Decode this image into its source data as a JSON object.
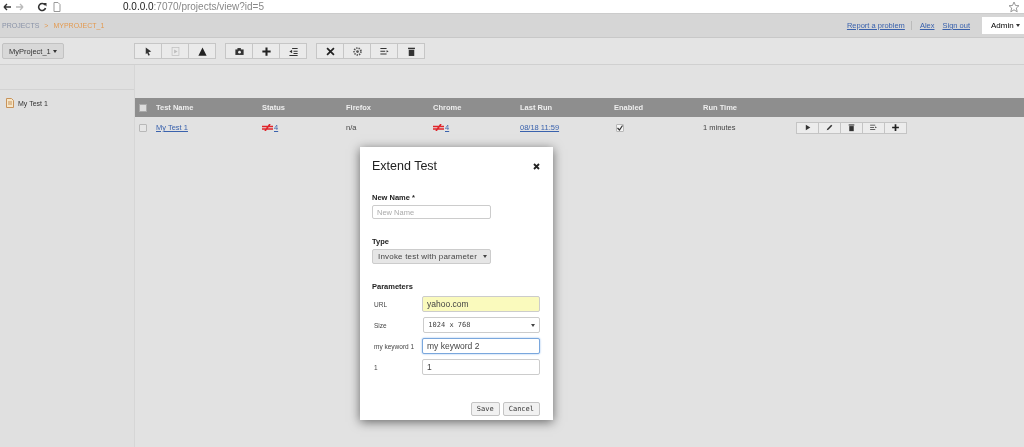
{
  "browser": {
    "url_host": "0.0.0.0",
    "url_path": ":7070/projects/view?id=5"
  },
  "breadcrumb": {
    "items": [
      "PROJECTS",
      "MYPROJECT_1"
    ],
    "separator": ">"
  },
  "header_links": [
    "Report a problem",
    "Alex",
    "Sign out"
  ],
  "user_menu": "Admin",
  "project_menu": "MyProject_1",
  "toolbar": [
    [
      {
        "kind": "cursor",
        "disabled": false
      },
      {
        "kind": "play-frame",
        "disabled": true
      },
      {
        "kind": "warning",
        "disabled": false
      }
    ],
    [
      {
        "kind": "camera",
        "disabled": false
      },
      {
        "kind": "plus",
        "disabled": false
      },
      {
        "kind": "outdent",
        "disabled": false
      }
    ],
    [
      {
        "kind": "tools",
        "disabled": false
      },
      {
        "kind": "gear",
        "disabled": false
      },
      {
        "kind": "list-arrow",
        "disabled": false
      },
      {
        "kind": "trash",
        "disabled": false
      }
    ]
  ],
  "sidebar": {
    "items": [
      "My Test 1"
    ]
  },
  "table": {
    "all_checked": false,
    "columns": [
      "Test Name",
      "Status",
      "Firefox",
      "Chrome",
      "Last Run",
      "Enabled",
      "Run Time"
    ],
    "rows": [
      {
        "checked": false,
        "name": "My Test 1",
        "status": "4",
        "firefox": "n/a",
        "chrome": "4",
        "last_run": "08/18 11:59",
        "enabled": true,
        "run_time": "1 minutes",
        "actions": [
          {
            "kind": "play"
          },
          {
            "kind": "pencil"
          },
          {
            "kind": "trash"
          },
          {
            "kind": "list-arrow"
          },
          {
            "kind": "plus"
          }
        ]
      }
    ]
  },
  "modal": {
    "title": "Extend Test",
    "name_label": "New Name *",
    "name_placeholder": "New Name",
    "type_label": "Type",
    "type_value": "Invoke test with parameter",
    "parameters_label": "Parameters",
    "parameters": [
      {
        "label": "URL",
        "kind": "text",
        "value": "yahoo.com",
        "highlighted": true,
        "focused": false
      },
      {
        "label": "Size",
        "kind": "select",
        "value": "1024 x 768",
        "highlighted": false,
        "focused": false
      },
      {
        "label": "my keyword 1",
        "kind": "text",
        "value": "my keyword 2",
        "highlighted": false,
        "focused": true
      },
      {
        "label": "1",
        "kind": "text",
        "value": "1",
        "highlighted": false,
        "focused": false
      }
    ],
    "buttons": [
      "Save",
      "Cancel"
    ]
  }
}
